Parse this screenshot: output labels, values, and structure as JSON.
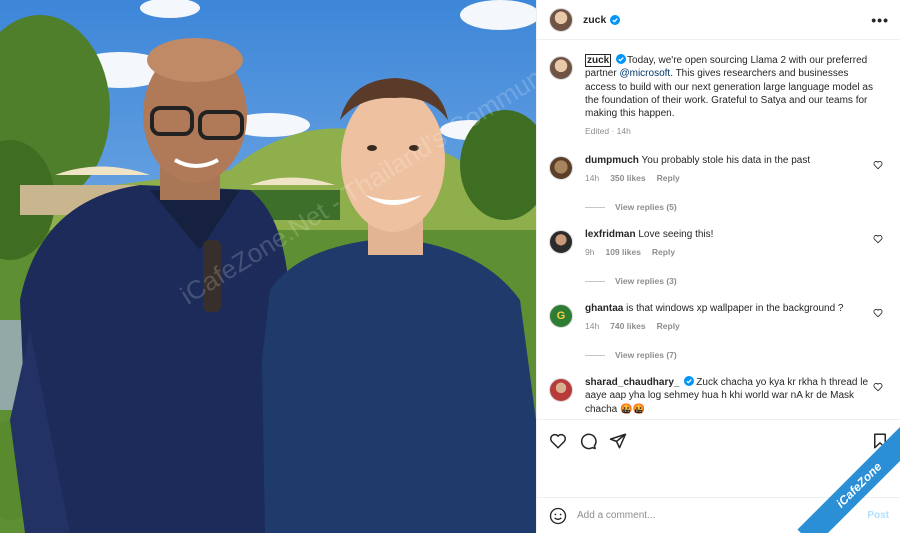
{
  "header": {
    "username": "zuck"
  },
  "caption": {
    "username": "zuck",
    "text_before": "Today, we're open sourcing Llama 2 with our preferred partner ",
    "mention": "@microsoft",
    "text_after": ". This gives researchers and businesses access to build with our next generation large language model as the foundation of their work. Grateful to Satya and our teams for making this happen.",
    "meta": "Edited · 14h"
  },
  "comments": [
    {
      "username": "dumpmuch",
      "text": "You probably stole his data in the past",
      "time": "14h",
      "likes": "350 likes",
      "reply": "Reply",
      "view_replies": "View replies (5)",
      "verified": false
    },
    {
      "username": "lexfridman",
      "text": "Love seeing this!",
      "time": "9h",
      "likes": "109 likes",
      "reply": "Reply",
      "view_replies": "View replies (3)",
      "verified": false
    },
    {
      "username": "ghantaa",
      "text": "is that windows xp wallpaper in the background ?",
      "time": "14h",
      "likes": "740 likes",
      "reply": "Reply",
      "view_replies": "View replies (7)",
      "verified": false
    },
    {
      "username": "sharad_chaudhary_",
      "text": "Zuck chacha yo kya kr rkha h thread le aaye aap yha log sehmey hua h khi world war nA kr de Mask chacha 🤬🤬",
      "verified": true
    }
  ],
  "add_comment": {
    "placeholder": "Add a comment...",
    "post_label": "Post"
  },
  "watermark": {
    "text": "iCafeZone.Net - Thailand's Community",
    "ribbon": "iCafeZone"
  },
  "colors": {
    "verified": "#0095f6",
    "link": "#00376b",
    "muted": "#8e8e8e"
  },
  "icons": [
    "more-icon",
    "verified-icon",
    "heart-icon",
    "comment-icon",
    "share-icon",
    "save-icon",
    "emoji-icon"
  ]
}
